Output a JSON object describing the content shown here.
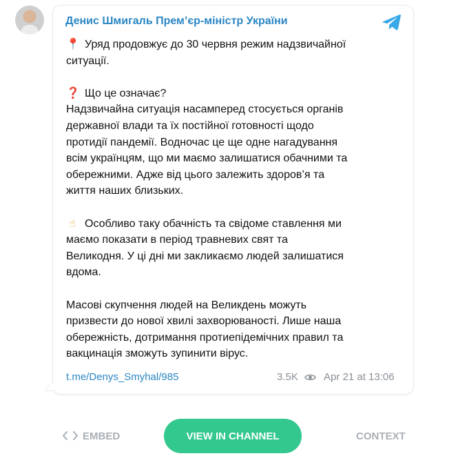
{
  "post": {
    "author": "Денис Шмигаль Прем’єр-міністр України",
    "lines": {
      "l1": "Уряд продовжує до 30 червня режим надзвичайної",
      "l2": "ситуації.",
      "l3": "Що це означає?",
      "l4": "Надзвичайна ситуація насамперед стосується органів",
      "l5": "державної влади та їх постійної готовності щодо",
      "l6": "протидії пандемії. Водночас це ще одне нагадування",
      "l7": "всім українцям, що ми маємо залишатися обачними та",
      "l8": "обережними. Адже від цього залежить здоров’я та",
      "l9": "життя наших близьких.",
      "l10": "Особливо таку обачність та свідоме ставлення ми",
      "l11": "маємо показати в період травневих свят та",
      "l12": "Великодня. У ці дні ми закликаємо людей залишатися",
      "l13": "вдома.",
      "l14": "Масові скупчення людей на Великдень можуть",
      "l15": "призвести до нової хвилі захворюваності. Лише наша",
      "l16": "обережність, дотримання протиепідемічних правил та",
      "l17": "вакцинація зможуть зупинити вірус."
    },
    "emoji": {
      "pin": "📍",
      "question": "❓",
      "hand": "☝"
    },
    "link": "t.me/Denys_Smyhal/985",
    "views": "3.5K",
    "date": "Apr 21 at 13:06"
  },
  "actions": {
    "embed": "EMBED",
    "view": "VIEW IN CHANNEL",
    "context": "CONTEXT"
  },
  "icons": {
    "telegram": "telegram-icon",
    "eye": "eye-icon",
    "code": "code-icon"
  },
  "colors": {
    "accent": "#2a86c4",
    "button": "#32c88e",
    "muted": "#a9afb5"
  }
}
